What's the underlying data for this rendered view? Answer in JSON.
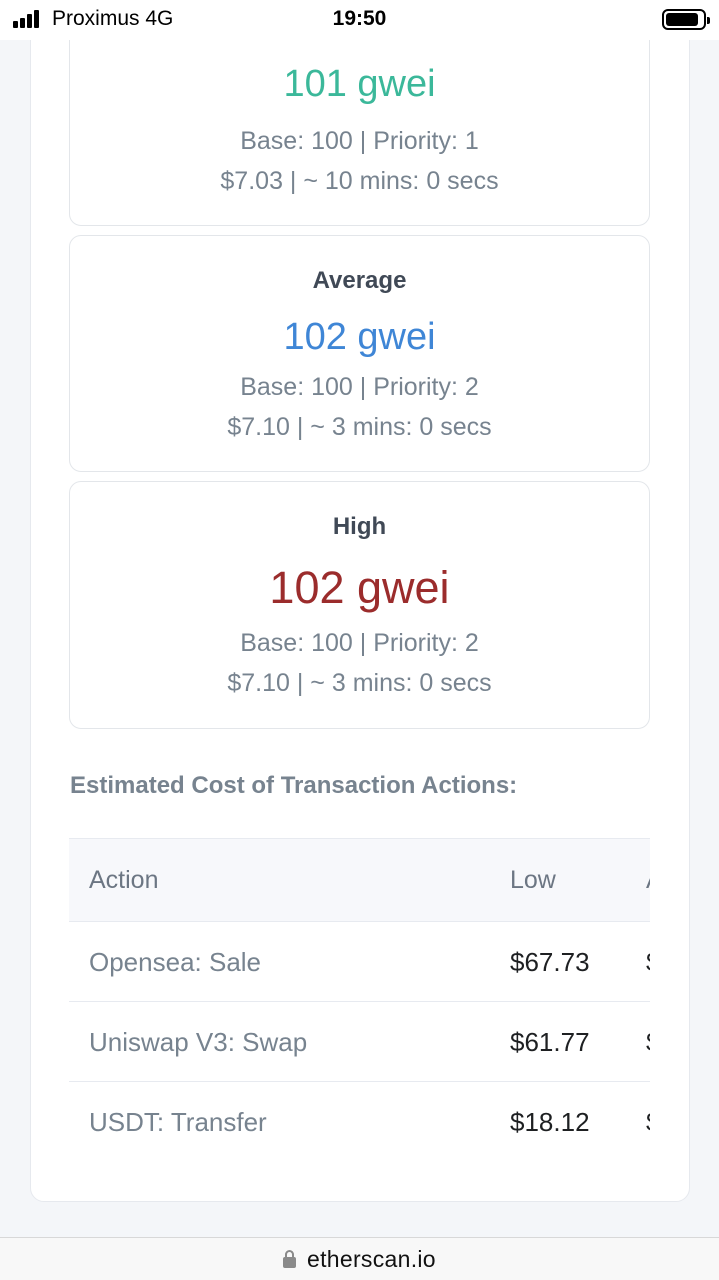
{
  "status_bar": {
    "carrier": "Proximus  4G",
    "time": "19:50"
  },
  "gas_cards": {
    "low": {
      "title": "",
      "value": "101 gwei",
      "color": "#3bb89a",
      "base_priority": "Base: 100 | Priority: 1",
      "cost_time": "$7.03 | ~ 10 mins: 0 secs"
    },
    "average": {
      "title": "Average",
      "value": "102 gwei",
      "color": "#3f86d6",
      "base_priority": "Base: 100 | Priority: 2",
      "cost_time": "$7.10 | ~ 3 mins: 0 secs"
    },
    "high": {
      "title": "High",
      "value": "102 gwei",
      "color": "#9b2c2c",
      "base_priority": "Base: 100 | Priority: 2",
      "cost_time": "$7.10 | ~ 3 mins: 0 secs"
    }
  },
  "actions_section": {
    "heading": "Estimated Cost of Transaction Actions:",
    "columns": [
      "Action",
      "Low",
      "A"
    ],
    "rows": [
      {
        "action": "Opensea: Sale",
        "low": "$67.73",
        "next": "$"
      },
      {
        "action": "Uniswap V3: Swap",
        "low": "$61.77",
        "next": "$"
      },
      {
        "action": "USDT: Transfer",
        "low": "$18.12",
        "next": "$"
      }
    ]
  },
  "url_bar": {
    "domain": "etherscan.io"
  },
  "icons": [
    "signal-icon",
    "battery-icon",
    "lock-icon"
  ]
}
